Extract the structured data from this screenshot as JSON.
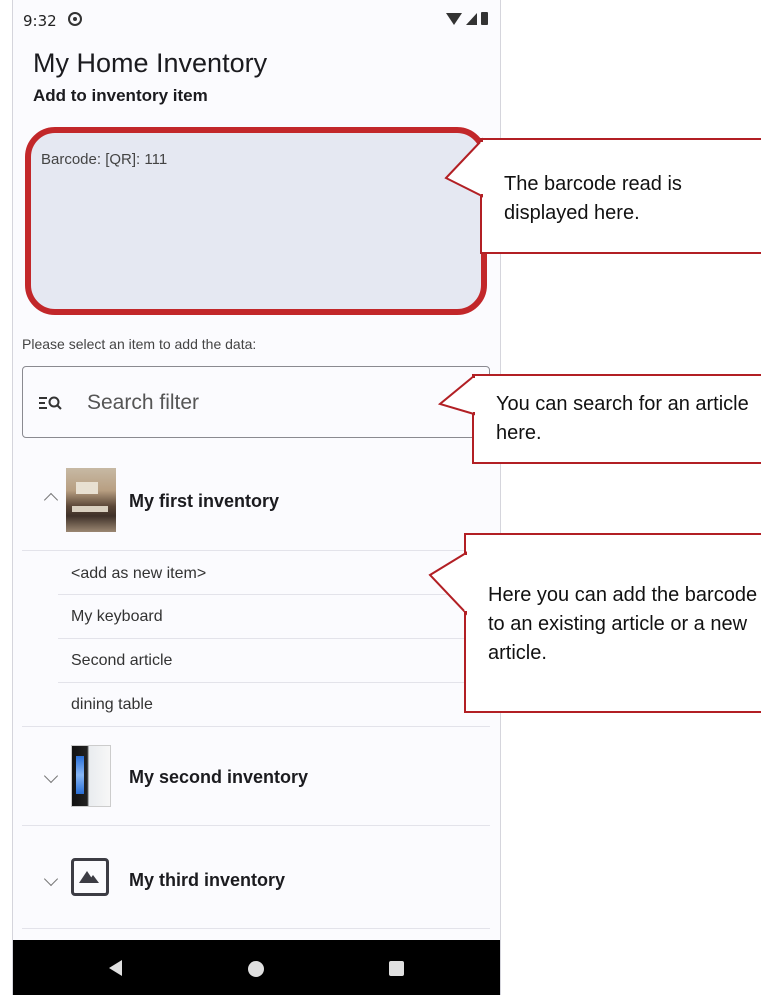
{
  "statusbar": {
    "time": "9:32"
  },
  "app": {
    "title": "My Home Inventory",
    "subtitle": "Add to inventory item"
  },
  "barcode": {
    "text": "Barcode: [QR]: 111"
  },
  "select_label": "Please select an item to add the data:",
  "search": {
    "placeholder": "Search filter"
  },
  "groups": [
    {
      "title": "My first inventory",
      "expanded": true,
      "items": [
        "<add as new item>",
        "My keyboard",
        "Second article",
        "dining table"
      ]
    },
    {
      "title": "My second inventory",
      "expanded": false
    },
    {
      "title": "My third inventory",
      "expanded": false
    }
  ],
  "callouts": [
    {
      "text": "The barcode read is displayed here."
    },
    {
      "text": "You can search for an article here."
    },
    {
      "text": "Here you can add the barcode to an existing article or a new article."
    }
  ],
  "colors": {
    "highlight": "#c2272a",
    "callout_border": "#b21f24",
    "barcode_bg": "#e5e8f2"
  }
}
